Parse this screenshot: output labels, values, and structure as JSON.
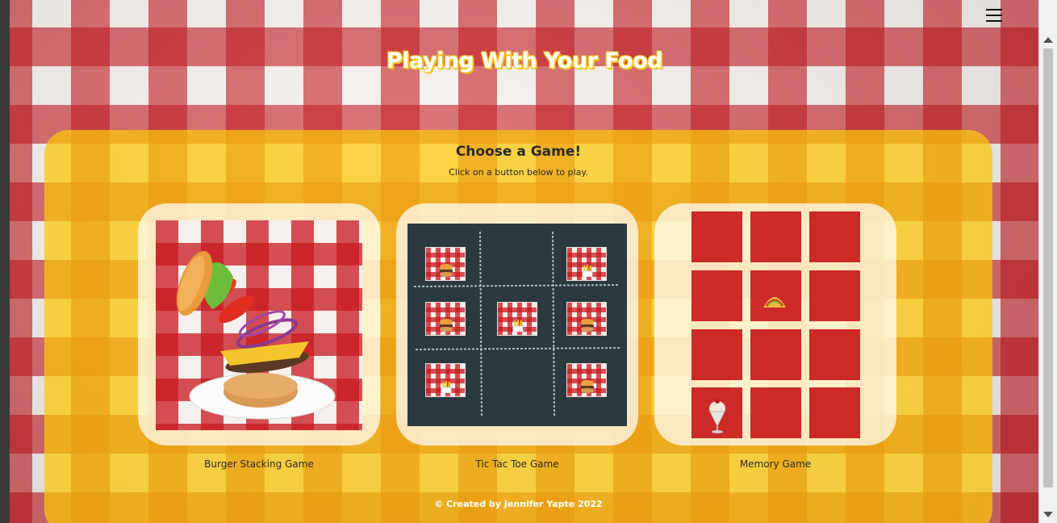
{
  "site": {
    "title": "Playing With Your Food"
  },
  "panel": {
    "heading": "Choose a Game!",
    "subheading": "Click on a button below to play."
  },
  "games": [
    {
      "label": "Burger Stacking Game",
      "icon": "burger-stack-image"
    },
    {
      "label": "Tic Tac Toe Game",
      "icon": "tic-tac-toe-board-image"
    },
    {
      "label": "Memory Game",
      "icon": "memory-cards-image"
    }
  ],
  "footer": {
    "credit": "© Created by Jennifer Yapte 2022"
  },
  "icons": {
    "menu": "hamburger-menu-icon"
  },
  "colors": {
    "panel_yellow": "#FAC60A",
    "tablecloth_red": "#C4161C",
    "memory_card_red": "#C40A0E",
    "board_slate": "#2B3A3F"
  }
}
